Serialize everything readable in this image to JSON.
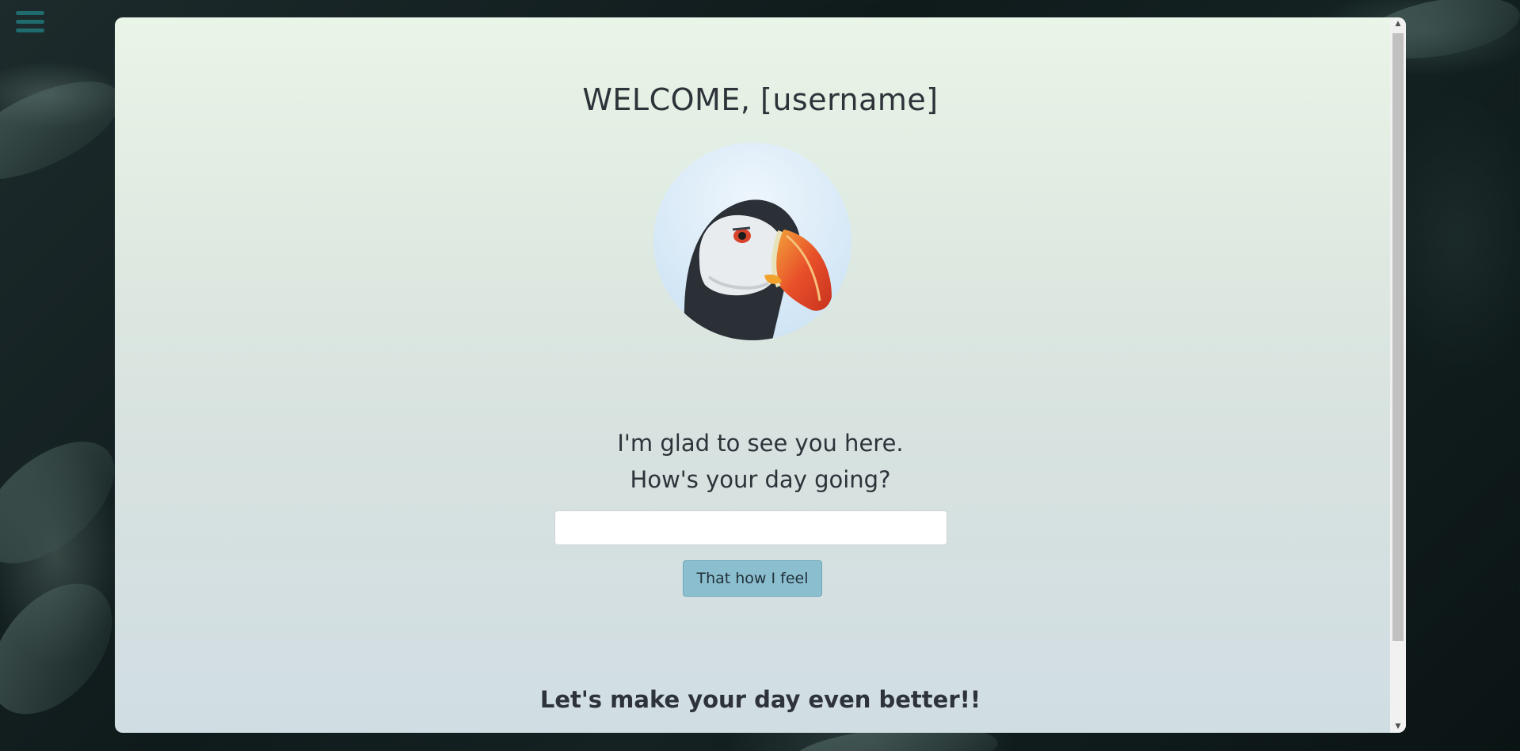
{
  "menu": {
    "icon": "hamburger-menu-icon",
    "color": "#1f6b6e"
  },
  "header": {
    "title": "WELCOME, [username]"
  },
  "avatar": {
    "alt": "puffin"
  },
  "greeting": {
    "line1": "I'm glad to see you here.",
    "line2": "How's your day going?"
  },
  "mood_form": {
    "input_value": "",
    "button_label": "That how I feel",
    "button_color": "#8bbfcf"
  },
  "footer": {
    "heading": "Let's make your day even better!!"
  },
  "scrollbar": {
    "up_icon": "scroll-up-arrow-icon",
    "down_icon": "scroll-down-arrow-icon"
  }
}
